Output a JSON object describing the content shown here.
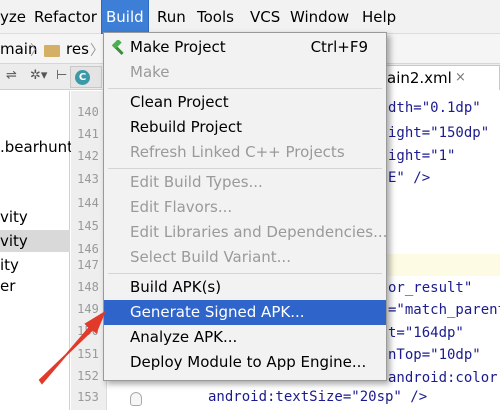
{
  "menubar": {
    "items": [
      "yze",
      "Refactor",
      "Build",
      "Run",
      "Tools",
      "VCS",
      "Window",
      "Help"
    ],
    "active": "Build"
  },
  "navbar": {
    "crumbs": [
      "main",
      "res"
    ]
  },
  "editor_tabs": {
    "xml_tab": "ain2.xml",
    "xml_close": "×"
  },
  "project_panel": {
    "lines": [
      ".bearhunt",
      "vity",
      "vity",
      "ity",
      "er"
    ]
  },
  "gutter": {
    "line_numbers": [
      "140",
      "141",
      "142",
      "143",
      "144",
      "145",
      "146",
      "147",
      "148",
      "149",
      "150",
      "151",
      "152",
      "153"
    ]
  },
  "code": {
    "l140": "dth=\"0.1dp\"",
    "l141": "ight=\"150dp\"",
    "l142": "ight=\"1\"",
    "l143": "E\" />",
    "l148": "or_result\"",
    "l149": "=\"match_parent",
    "l150": "t=\"164dp\"",
    "l151": "nTop=\"10dp\"",
    "l152": "android:color",
    "l153": "android:textSize=\"20sp\" />"
  },
  "build_menu": {
    "make_project": "Make Project",
    "make_project_shortcut": "Ctrl+F9",
    "make": "Make",
    "clean_project": "Clean Project",
    "rebuild_project": "Rebuild Project",
    "refresh_linked": "Refresh Linked C++ Projects",
    "edit_build_types": "Edit Build Types...",
    "edit_flavors": "Edit Flavors...",
    "edit_libraries": "Edit Libraries and Dependencies...",
    "select_build_variant": "Select Build Variant...",
    "build_apks": "Build APK(s)",
    "generate_signed_apk": "Generate Signed APK...",
    "analyze_apk": "Analyze APK...",
    "deploy_module": "Deploy Module to App Engine..."
  },
  "colors": {
    "highlight": "#2f65ca",
    "arrow": "#e23a2a",
    "menu_active": "#3d7fd6"
  },
  "icons": [
    "hammer-icon",
    "folder-icon",
    "gear-icon",
    "chevron-right-icon",
    "close-icon",
    "fold-icon",
    "red-arrow-annotation"
  ]
}
